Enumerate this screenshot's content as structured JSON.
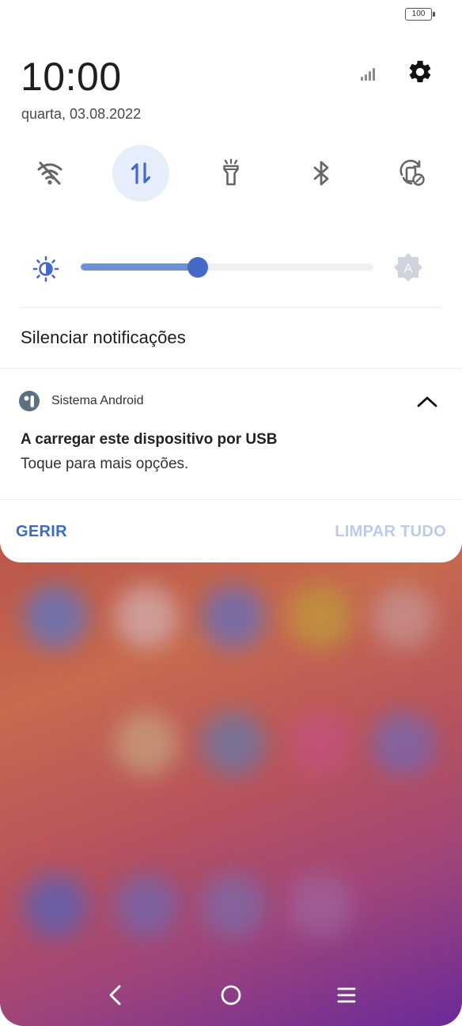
{
  "status_bar": {
    "battery_level": "100"
  },
  "header": {
    "time": "10:00",
    "date": "quarta, 03.08.2022",
    "signal_icon": "signal-strength-icon",
    "settings_icon": "gear-icon"
  },
  "quick_toggles": [
    {
      "name": "wifi",
      "icon": "wifi-off-icon",
      "active": false
    },
    {
      "name": "mobile-data",
      "icon": "mobile-data-arrows-icon",
      "active": true
    },
    {
      "name": "flashlight",
      "icon": "flashlight-icon",
      "active": false
    },
    {
      "name": "bluetooth",
      "icon": "bluetooth-icon",
      "active": false
    },
    {
      "name": "auto-rotate",
      "icon": "rotation-lock-icon",
      "active": false
    }
  ],
  "brightness": {
    "level": 0.4,
    "auto_icon": "auto-brightness-icon",
    "sun_icon": "brightness-icon"
  },
  "silence": {
    "label": "Silenciar notificações"
  },
  "notification": {
    "app_name": "Sistema Android",
    "title": "A carregar este dispositivo por USB",
    "text": "Toque para mais opções.",
    "expand_icon": "chevron-up-icon"
  },
  "actions": {
    "manage_label": "GERIR",
    "clear_label": "LIMPAR TUDO"
  },
  "colors": {
    "accent": "#3c6ac4",
    "toggle_active_bg": "#e7eefb",
    "slider_fill": "#6f8fde"
  },
  "navbar": {
    "back_icon": "back-icon",
    "home_icon": "home-icon",
    "recents_icon": "recents-icon"
  }
}
